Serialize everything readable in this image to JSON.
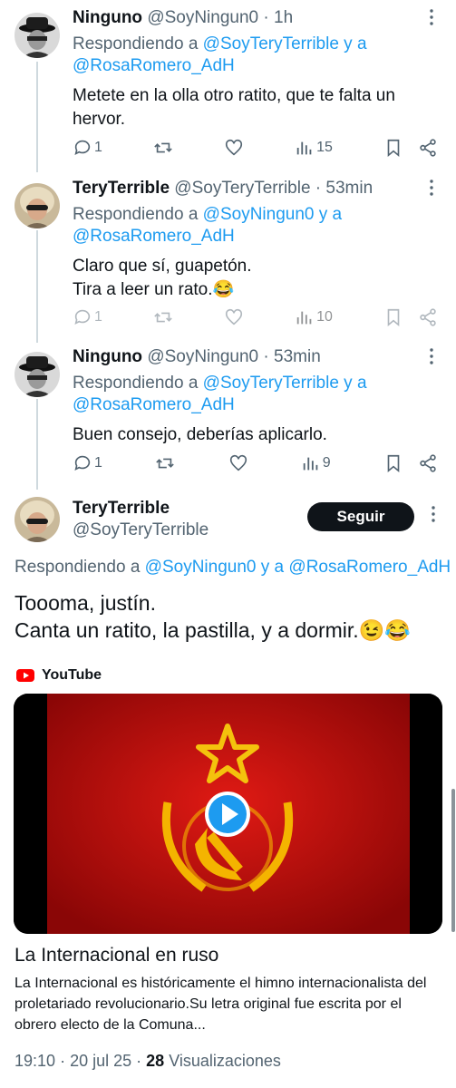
{
  "colors": {
    "accent": "#1d9bf0",
    "text": "#0f1419",
    "muted": "#536471",
    "youtube": "#ff0000"
  },
  "replies": [
    {
      "name": "Ninguno",
      "handle": "@SoyNingun0",
      "time": "· 1h",
      "replying_prefix": "Respondiendo a",
      "replying_user1": "@SoyTeryTerrible",
      "replying_sep": "y a",
      "replying_user2": "@RosaRomero_AdH",
      "text": "Metete en la olla otro ratito, que te falta un hervor.",
      "replies_count": "1",
      "views": "15",
      "avatar": "man-hat-avatar"
    },
    {
      "name": "TeryTerrible",
      "handle": "@SoyTeryTerrible",
      "time": "· 53min",
      "replying_prefix": "Respondiendo a",
      "replying_user1": "@SoyNingun0",
      "replying_sep": "y a",
      "replying_user2": "@RosaRomero_AdH",
      "text_line1": "Claro que sí, guapetón.",
      "text_line2": "Tira a leer un rato.😂",
      "replies_count": "1",
      "views": "10",
      "avatar": "woman-sunglasses-avatar"
    },
    {
      "name": "Ninguno",
      "handle": "@SoyNingun0",
      "time": "· 53min",
      "replying_prefix": "Respondiendo a",
      "replying_user1": "@SoyTeryTerrible",
      "replying_sep": "y a",
      "replying_user2": "@RosaRomero_AdH",
      "text": "Buen consejo, deberías aplicarlo.",
      "replies_count": "1",
      "views": "9",
      "avatar": "man-hat-avatar"
    }
  ],
  "main_tweet": {
    "name": "TeryTerrible",
    "handle": "@SoyTeryTerrible",
    "follow_label": "Seguir",
    "replying_prefix": "Respondiendo a",
    "replying_user1": "@SoyNingun0",
    "replying_sep": "y a",
    "replying_user2": "@RosaRomero_AdH",
    "text_line1": "Toooma, justín.",
    "text_line2": "Canta un ratito, la pastilla, y a dormir.😉😂",
    "card": {
      "source": "YouTube",
      "title": "La Internacional en ruso",
      "description": "La Internacional es históricamente el himno internacionalista del proletariado revolucionario.Su letra original fue escrita por el obrero electo de la Comuna..."
    },
    "time": "19:10",
    "date": "20 jul 25",
    "views_count": "28",
    "views_label": "Visualizaciones"
  }
}
